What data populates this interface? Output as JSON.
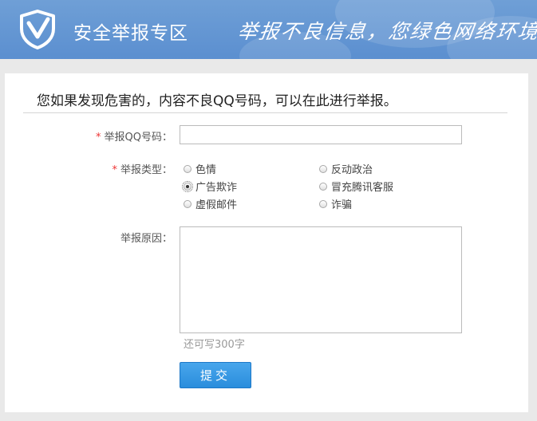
{
  "header": {
    "title": "安全举报专区",
    "slogan": "举报不良信息，您绿色网络环境"
  },
  "form": {
    "intro": "您如果发现危害的，内容不良QQ号码，可以在此进行举报。",
    "qq_label": "举报QQ号码：",
    "qq_value": "",
    "type_label": "举报类型：",
    "types": [
      {
        "label": "色情",
        "checked": false
      },
      {
        "label": "反动政治",
        "checked": false
      },
      {
        "label": "广告欺诈",
        "checked": true
      },
      {
        "label": "冒充腾讯客服",
        "checked": false
      },
      {
        "label": "虚假邮件",
        "checked": false
      },
      {
        "label": "诈骗",
        "checked": false
      }
    ],
    "reason_label": "举报原因：",
    "reason_value": "",
    "counter_text": "还可写300字",
    "submit_label": "提交"
  },
  "colors": {
    "header_bg": "#5b8fd0",
    "required_star": "#e33333",
    "button_bg": "#2a8ddc"
  },
  "icons": {
    "logo": "shield-check-icon"
  }
}
